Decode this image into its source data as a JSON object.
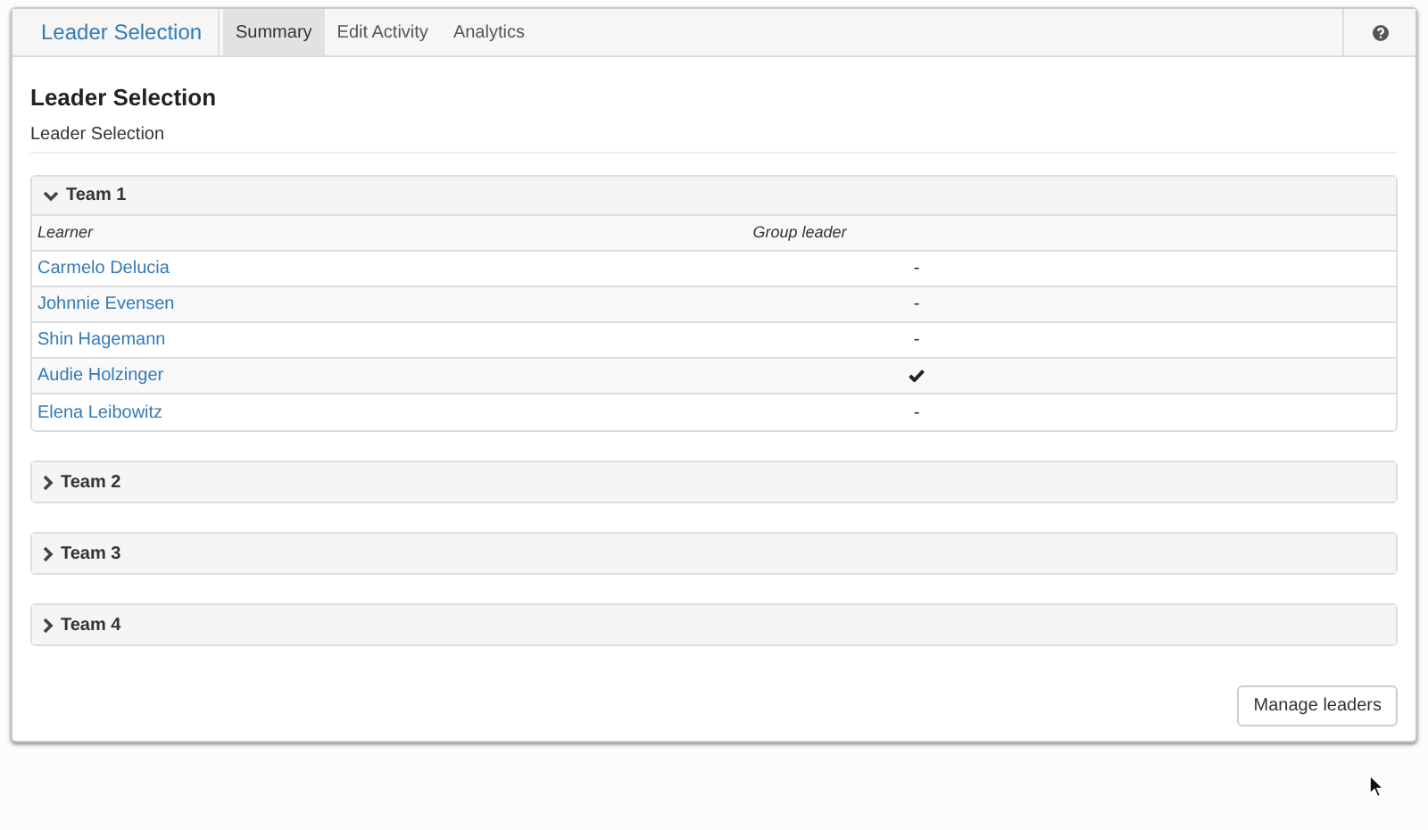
{
  "navbar": {
    "brand": "Leader Selection",
    "tabs": [
      {
        "label": "Summary",
        "selected": true
      },
      {
        "label": "Edit Activity",
        "selected": false
      },
      {
        "label": "Analytics",
        "selected": false
      }
    ]
  },
  "page": {
    "title": "Leader Selection",
    "subtitle": "Leader Selection"
  },
  "teams": [
    {
      "name": "Team 1",
      "expanded": true,
      "columns": [
        "Learner",
        "Group leader"
      ],
      "rows": [
        {
          "learner": "Carmelo Delucia",
          "leader": false,
          "group_leader": "-"
        },
        {
          "learner": "Johnnie Evensen",
          "leader": false,
          "group_leader": "-"
        },
        {
          "learner": "Shin Hagemann",
          "leader": false,
          "group_leader": "-"
        },
        {
          "learner": "Audie Holzinger",
          "leader": true
        },
        {
          "learner": "Elena Leibowitz",
          "leader": false,
          "group_leader": "-"
        }
      ]
    },
    {
      "name": "Team 2",
      "expanded": false
    },
    {
      "name": "Team 3",
      "expanded": false
    },
    {
      "name": "Team 4",
      "expanded": false
    }
  ],
  "buttons": [
    "Manage leaders"
  ]
}
